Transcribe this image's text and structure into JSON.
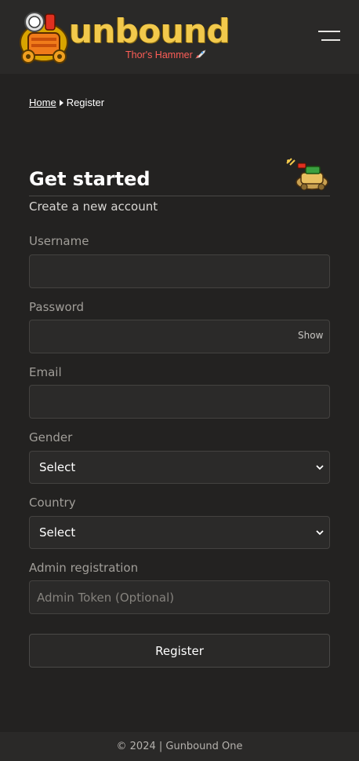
{
  "header": {
    "logo_text": "unbound",
    "logo_subtitle": "Thor's Hammer",
    "accent_color": "#f2c94c",
    "subtitle_color": "#ff5e57",
    "menu_icon": "hamburger-menu-icon"
  },
  "breadcrumb": {
    "home": "Home",
    "current": "Register"
  },
  "form": {
    "title": "Get started",
    "subtitle": "Create a new account",
    "username_label": "Username",
    "username_value": "",
    "password_label": "Password",
    "password_value": "",
    "password_toggle": "Show",
    "email_label": "Email",
    "email_value": "",
    "gender_label": "Gender",
    "gender_value": "Select",
    "country_label": "Country",
    "country_value": "Select",
    "admin_label": "Admin registration",
    "admin_placeholder": "Admin Token (Optional)",
    "admin_value": "",
    "submit_label": "Register"
  },
  "footer": {
    "text": "© 2024 | Gunbound One"
  }
}
